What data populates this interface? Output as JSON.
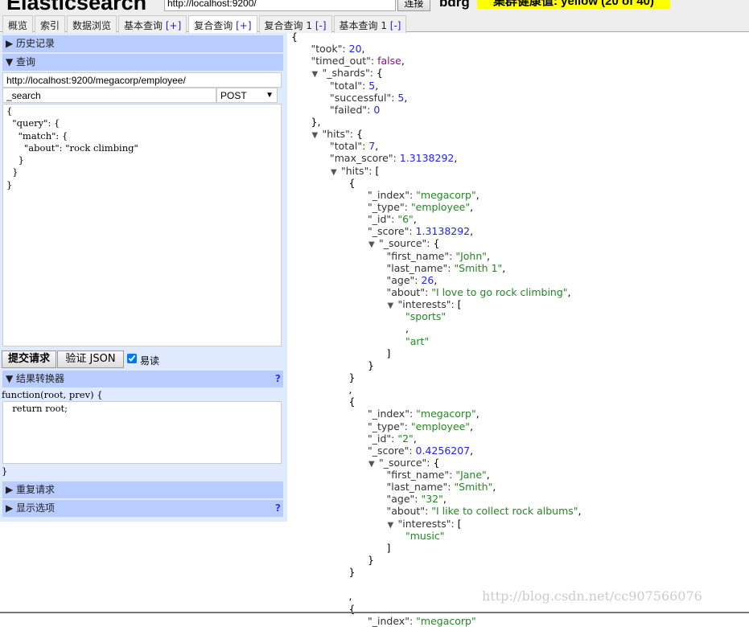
{
  "header": {
    "logo": "Elasticsearch",
    "url": "http://localhost:9200/",
    "connect": "连接",
    "cluster": "bdrg",
    "health": "集群健康值: yellow (20 of 40)",
    "health_color": "#ffff00"
  },
  "tabs": [
    {
      "label": "概览",
      "pm": ""
    },
    {
      "label": "索引",
      "pm": ""
    },
    {
      "label": "数据浏览",
      "pm": ""
    },
    {
      "label": "基本查询 ",
      "pm": "[+]"
    },
    {
      "label": "复合查询 ",
      "pm": "[+]",
      "active": true
    },
    {
      "label": "复合查询 1 ",
      "pm": "[-]"
    },
    {
      "label": "基本查询 1 ",
      "pm": "[-]"
    }
  ],
  "left": {
    "history": "▶ 历史记录",
    "query": "▼ 查询",
    "url": "http://localhost:9200/megacorp/employee/",
    "path": "_search",
    "method": "POST",
    "body": "{\n  \"query\": {\n    \"match\": {\n      \"about\": \"rock climbing\"\n    }\n  }\n}",
    "submit": "提交请求",
    "validate": "验证 JSON",
    "pretty": "易读",
    "pretty_checked": true,
    "transformer": "▼ 结果转换器",
    "help": "?",
    "fn_head": "function(root, prev) {",
    "fn_body": "  return root;",
    "fn_tail": "}",
    "repeat": "▶ 重复请求",
    "display": "▶ 显示选项"
  },
  "result": [
    {
      "i": 0,
      "t": "{"
    },
    {
      "i": 1,
      "k": "took",
      "v": "20",
      "c": "n",
      "e": ","
    },
    {
      "i": 1,
      "k": "timed_out",
      "v": "false",
      "c": "b",
      "e": ","
    },
    {
      "i": 1,
      "tg": 1,
      "k": "_shards",
      "t": "{"
    },
    {
      "i": 2,
      "k": "total",
      "v": "5",
      "c": "n",
      "e": ","
    },
    {
      "i": 2,
      "k": "successful",
      "v": "5",
      "c": "n",
      "e": ","
    },
    {
      "i": 2,
      "k": "failed",
      "v": "0",
      "c": "n"
    },
    {
      "i": 1,
      "t": "},"
    },
    {
      "i": 1,
      "tg": 1,
      "k": "hits",
      "t": "{"
    },
    {
      "i": 2,
      "k": "total",
      "v": "7",
      "c": "n",
      "e": ","
    },
    {
      "i": 2,
      "k": "max_score",
      "v": "1.3138292",
      "c": "n",
      "e": ","
    },
    {
      "i": 2,
      "tg": 1,
      "k": "hits",
      "t": "["
    },
    {
      "i": 3,
      "t": "{"
    },
    {
      "i": 4,
      "k": "_index",
      "v": "\"megacorp\"",
      "c": "s",
      "e": ","
    },
    {
      "i": 4,
      "k": "_type",
      "v": "\"employee\"",
      "c": "s",
      "e": ","
    },
    {
      "i": 4,
      "k": "_id",
      "v": "\"6\"",
      "c": "s",
      "e": ","
    },
    {
      "i": 4,
      "k": "_score",
      "v": "1.3138292",
      "c": "n",
      "e": ","
    },
    {
      "i": 4,
      "tg": 1,
      "k": "_source",
      "t": "{"
    },
    {
      "i": 5,
      "k": "first_name",
      "v": "\"John\"",
      "c": "s",
      "e": ","
    },
    {
      "i": 5,
      "k": "last_name",
      "v": "\"Smith 1\"",
      "c": "s",
      "e": ","
    },
    {
      "i": 5,
      "k": "age",
      "v": "26",
      "c": "n",
      "e": ","
    },
    {
      "i": 5,
      "k": "about",
      "v": "\"I love to go rock climbing\"",
      "c": "s",
      "e": ","
    },
    {
      "i": 5,
      "tg": 1,
      "k": "interests",
      "t": "["
    },
    {
      "i": 6,
      "v": "\"sports\"",
      "c": "s"
    },
    {
      "i": 6,
      "t": ","
    },
    {
      "i": 6,
      "v": "\"art\"",
      "c": "s"
    },
    {
      "i": 5,
      "t": "]"
    },
    {
      "i": 4,
      "t": "}"
    },
    {
      "i": 3,
      "t": "}"
    },
    {
      "i": 3,
      "t": ","
    },
    {
      "i": 3,
      "t": "{"
    },
    {
      "i": 4,
      "k": "_index",
      "v": "\"megacorp\"",
      "c": "s",
      "e": ","
    },
    {
      "i": 4,
      "k": "_type",
      "v": "\"employee\"",
      "c": "s",
      "e": ","
    },
    {
      "i": 4,
      "k": "_id",
      "v": "\"2\"",
      "c": "s",
      "e": ","
    },
    {
      "i": 4,
      "k": "_score",
      "v": "0.4256207",
      "c": "n",
      "e": ","
    },
    {
      "i": 4,
      "tg": 1,
      "k": "_source",
      "t": "{"
    },
    {
      "i": 5,
      "k": "first_name",
      "v": "\"Jane\"",
      "c": "s",
      "e": ","
    },
    {
      "i": 5,
      "k": "last_name",
      "v": "\"Smith\"",
      "c": "s",
      "e": ","
    },
    {
      "i": 5,
      "k": "age",
      "v": "\"32\"",
      "c": "s",
      "e": ","
    },
    {
      "i": 5,
      "k": "about",
      "v": "\"I like to collect rock albums\"",
      "c": "s",
      "e": ","
    },
    {
      "i": 5,
      "tg": 1,
      "k": "interests",
      "t": "["
    },
    {
      "i": 6,
      "v": "\"music\"",
      "c": "s"
    },
    {
      "i": 5,
      "t": "]"
    },
    {
      "i": 4,
      "t": "}"
    },
    {
      "i": 3,
      "t": "}"
    },
    {
      "i": 3,
      "t": ""
    },
    {
      "i": 3,
      "t": ","
    },
    {
      "i": 3,
      "t": "{"
    },
    {
      "i": 4,
      "k": "_index",
      "v": "\"megacorp\"",
      "c": "s"
    }
  ],
  "watermark": "http://blog.csdn.net/cc907566076"
}
